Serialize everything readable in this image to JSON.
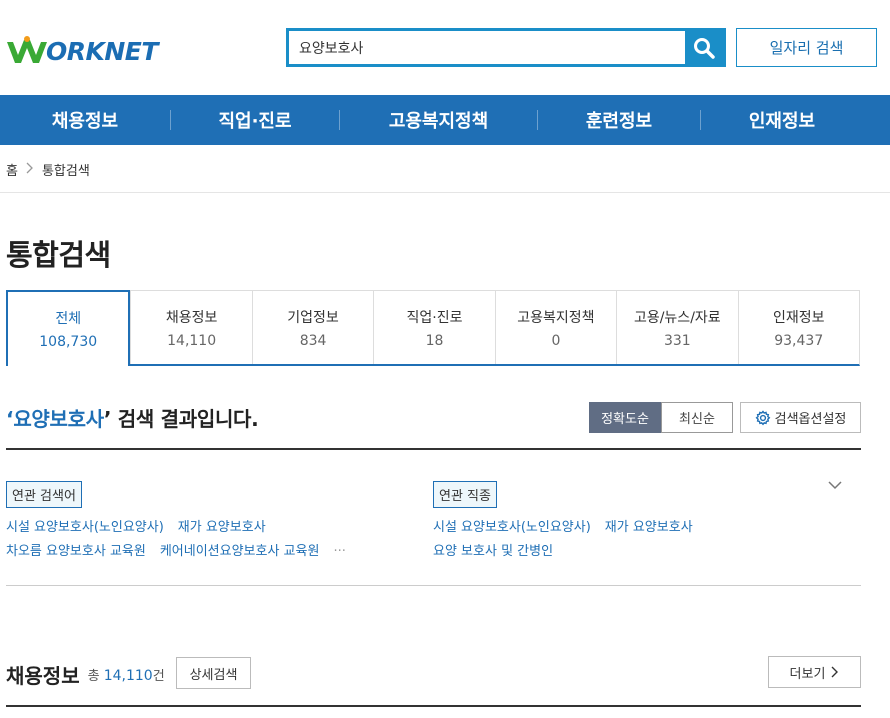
{
  "logo": {
    "text": "ORKNET"
  },
  "search": {
    "value": "요양보호사",
    "placeholder": ""
  },
  "header": {
    "job_search_label": "일자리 검색"
  },
  "gnb": {
    "items": [
      "채용정보",
      "직업·진로",
      "고용복지정책",
      "훈련정보",
      "인재정보"
    ]
  },
  "breadcrumb": {
    "home": "홈",
    "current": "통합검색"
  },
  "page": {
    "title": "통합검색"
  },
  "tabs": [
    {
      "label": "전체",
      "count": "108,730"
    },
    {
      "label": "채용정보",
      "count": "14,110"
    },
    {
      "label": "기업정보",
      "count": "834"
    },
    {
      "label": "직업·진로",
      "count": "18"
    },
    {
      "label": "고용복지정책",
      "count": "0"
    },
    {
      "label": "고용/뉴스/자료",
      "count": "331"
    },
    {
      "label": "인재정보",
      "count": "93,437"
    }
  ],
  "result": {
    "quote_open": "‘",
    "keyword": "요양보호사",
    "quote_close": "’",
    "suffix": " 검색 결과입니다."
  },
  "sort": {
    "accuracy": "정확도순",
    "latest": "최신순"
  },
  "options": {
    "label": "검색옵션설정"
  },
  "related_terms": {
    "label": "연관 검색어",
    "items": [
      "시설 요양보호사(노인요양사)",
      "재가 요양보호사",
      "차오름 요양보호사 교육원",
      "케어네이션요양보호사 교육원"
    ],
    "more": "···"
  },
  "related_jobs": {
    "label": "연관 직종",
    "items": [
      "시설 요양보호사(노인요양사)",
      "재가 요양보호사",
      "요양 보호사 및 간병인"
    ]
  },
  "section": {
    "title": "채용정보",
    "total_prefix": "총 ",
    "total_count": "14,110",
    "total_suffix": "건",
    "detail_label": "상세검색",
    "more_label": "더보기"
  },
  "colors": {
    "primary": "#1f6fb5",
    "search_border": "#1a8ec8",
    "logo_green": "#3aa935",
    "sort_active": "#606d84"
  },
  "icons": {
    "search": "search-icon",
    "gear": "gear-icon",
    "chevron": "chevron-down-icon",
    "more": "chevron-right-icon"
  }
}
